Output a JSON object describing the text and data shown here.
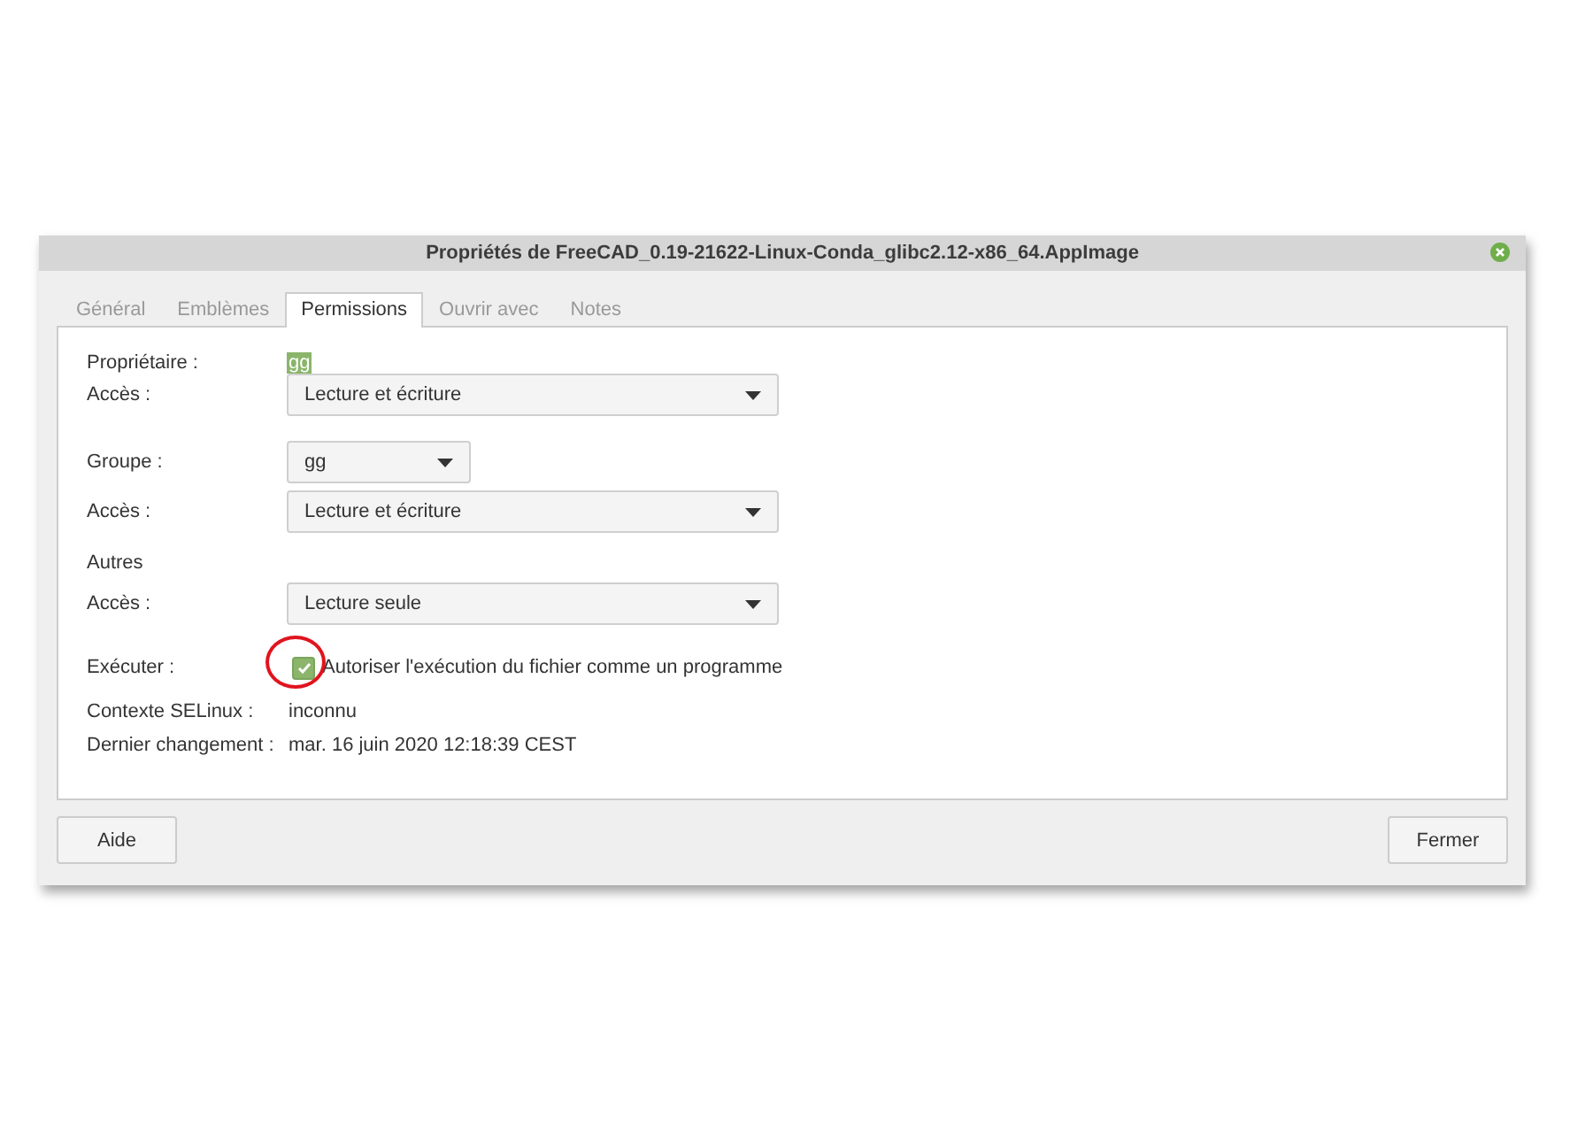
{
  "window": {
    "title": "Propriétés de FreeCAD_0.19-21622-Linux-Conda_glibc2.12-x86_64.AppImage"
  },
  "tabs": [
    {
      "label": "Général",
      "selected": false
    },
    {
      "label": "Emblèmes",
      "selected": false
    },
    {
      "label": "Permissions",
      "selected": true
    },
    {
      "label": "Ouvrir avec",
      "selected": false
    },
    {
      "label": "Notes",
      "selected": false
    }
  ],
  "rows": [
    {
      "kind": "text",
      "label": "Propriétaire :",
      "value": "gg",
      "selected": true
    },
    {
      "kind": "select",
      "label": "Accès :",
      "value": "Lecture et écriture",
      "wide": true
    },
    {
      "kind": "select",
      "label": "Groupe :",
      "value": "gg",
      "wide": false
    },
    {
      "kind": "select",
      "label": "Accès :",
      "value": "Lecture et écriture",
      "wide": true
    },
    {
      "kind": "heading",
      "label": "Autres"
    },
    {
      "kind": "select",
      "label": "Accès :",
      "value": "Lecture seule",
      "wide": true
    },
    {
      "kind": "checkbox",
      "label": "Exécuter :",
      "value": "Autoriser l'exécution du fichier comme un programme",
      "checked": true,
      "circled": true
    },
    {
      "kind": "text",
      "label": "Contexte SELinux :",
      "value": "inconnu",
      "selected": false
    },
    {
      "kind": "text",
      "label": "Dernier changement :",
      "value": "mar. 16 juin 2020 12:18:39 CEST",
      "selected": false
    }
  ],
  "buttons": {
    "left": "Aide",
    "right": "Fermer"
  }
}
